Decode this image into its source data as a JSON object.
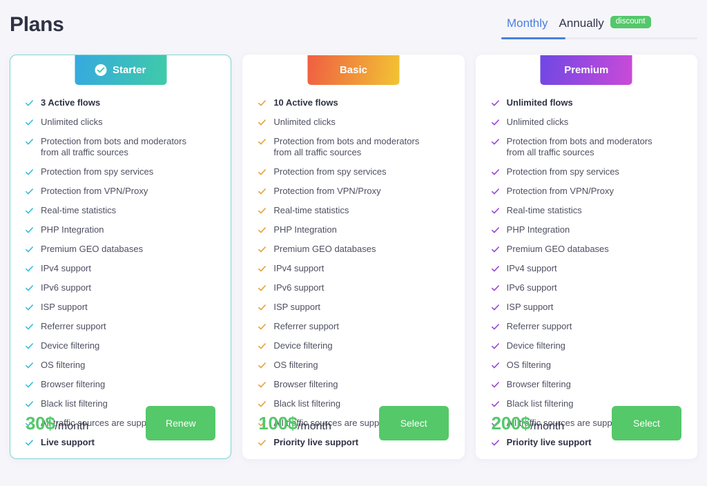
{
  "header": {
    "title": "Plans",
    "tabs": [
      {
        "label": "Monthly",
        "active": true
      },
      {
        "label": "Annually",
        "active": false,
        "badge": "discount"
      }
    ]
  },
  "plans": [
    {
      "name": "Starter",
      "current": true,
      "accent": "#3fcba8",
      "check_color": "#3bbfd6",
      "badge_icon": "check-circle-icon",
      "features": [
        {
          "text": "3 Active flows",
          "bold": true
        },
        {
          "text": "Unlimited clicks",
          "bold": false
        },
        {
          "text": "Protection from bots and moderators from all traffic sources",
          "bold": false
        },
        {
          "text": "Protection from spy services",
          "bold": false
        },
        {
          "text": "Protection from VPN/Proxy",
          "bold": false
        },
        {
          "text": "Real-time statistics",
          "bold": false
        },
        {
          "text": "PHP Integration",
          "bold": false
        },
        {
          "text": "Premium GEO databases",
          "bold": false
        },
        {
          "text": "IPv4 support",
          "bold": false
        },
        {
          "text": "IPv6 support",
          "bold": false
        },
        {
          "text": "ISP support",
          "bold": false
        },
        {
          "text": "Referrer support",
          "bold": false
        },
        {
          "text": "Device filtering",
          "bold": false
        },
        {
          "text": "OS filtering",
          "bold": false
        },
        {
          "text": "Browser filtering",
          "bold": false
        },
        {
          "text": "Black list filtering",
          "bold": false
        },
        {
          "text": "All traffic sources are supported",
          "bold": false
        },
        {
          "text": "Live support",
          "bold": true
        }
      ],
      "price_amount": "30$",
      "price_period": "/month",
      "cta_label": "Renew"
    },
    {
      "name": "Basic",
      "current": false,
      "accent": "#f2a339",
      "check_color": "#e7a43c",
      "badge_icon": null,
      "features": [
        {
          "text": "10 Active flows",
          "bold": true
        },
        {
          "text": "Unlimited clicks",
          "bold": false
        },
        {
          "text": "Protection from bots and moderators from all traffic sources",
          "bold": false
        },
        {
          "text": "Protection from spy services",
          "bold": false
        },
        {
          "text": "Protection from VPN/Proxy",
          "bold": false
        },
        {
          "text": "Real-time statistics",
          "bold": false
        },
        {
          "text": "PHP Integration",
          "bold": false
        },
        {
          "text": "Premium GEO databases",
          "bold": false
        },
        {
          "text": "IPv4 support",
          "bold": false
        },
        {
          "text": "IPv6 support",
          "bold": false
        },
        {
          "text": "ISP support",
          "bold": false
        },
        {
          "text": "Referrer support",
          "bold": false
        },
        {
          "text": "Device filtering",
          "bold": false
        },
        {
          "text": "OS filtering",
          "bold": false
        },
        {
          "text": "Browser filtering",
          "bold": false
        },
        {
          "text": "Black list filtering",
          "bold": false
        },
        {
          "text": "All traffic sources are supported",
          "bold": false
        },
        {
          "text": "Priority live support",
          "bold": true
        }
      ],
      "price_amount": "100$",
      "price_period": "/month",
      "cta_label": "Select"
    },
    {
      "name": "Premium",
      "current": false,
      "accent": "#a14ae0",
      "check_color": "#9b4ad4",
      "badge_icon": null,
      "features": [
        {
          "text": "Unlimited flows",
          "bold": true
        },
        {
          "text": "Unlimited clicks",
          "bold": false
        },
        {
          "text": "Protection from bots and moderators from all traffic sources",
          "bold": false
        },
        {
          "text": "Protection from spy services",
          "bold": false
        },
        {
          "text": "Protection from VPN/Proxy",
          "bold": false
        },
        {
          "text": "Real-time statistics",
          "bold": false
        },
        {
          "text": "PHP Integration",
          "bold": false
        },
        {
          "text": "Premium GEO databases",
          "bold": false
        },
        {
          "text": "IPv4 support",
          "bold": false
        },
        {
          "text": "IPv6 support",
          "bold": false
        },
        {
          "text": "ISP support",
          "bold": false
        },
        {
          "text": "Referrer support",
          "bold": false
        },
        {
          "text": "Device filtering",
          "bold": false
        },
        {
          "text": "OS filtering",
          "bold": false
        },
        {
          "text": "Browser filtering",
          "bold": false
        },
        {
          "text": "Black list filtering",
          "bold": false
        },
        {
          "text": "All traffic sources are supported",
          "bold": false
        },
        {
          "text": "Priority live support",
          "bold": true
        }
      ],
      "price_amount": "200$",
      "price_period": "/month",
      "cta_label": "Select"
    }
  ]
}
